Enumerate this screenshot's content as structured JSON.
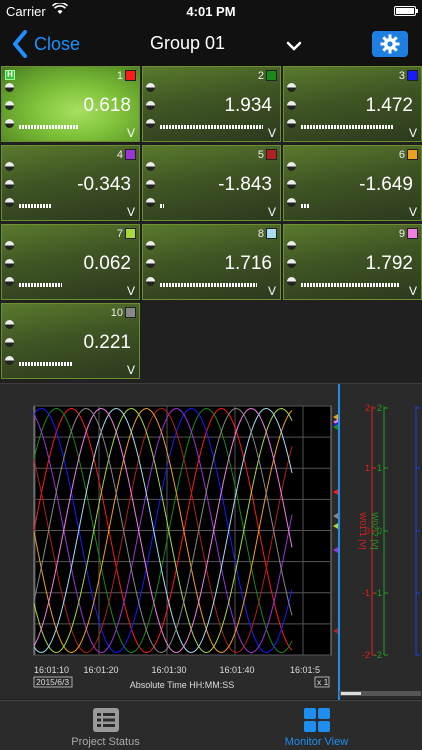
{
  "status_bar": {
    "carrier": "Carrier",
    "time": "4:01 PM"
  },
  "nav": {
    "back_label": "Close",
    "title": "Group 01"
  },
  "channels": [
    {
      "num": "1",
      "value": "0.618",
      "unit": "V",
      "color": "#ff1a1a",
      "level": 0.55,
      "highlight": true,
      "badge": "H"
    },
    {
      "num": "2",
      "value": "1.934",
      "unit": "V",
      "color": "#1a8a1a",
      "level": 0.95
    },
    {
      "num": "3",
      "value": "1.472",
      "unit": "V",
      "color": "#1a1aff",
      "level": 0.85
    },
    {
      "num": "4",
      "value": "-0.343",
      "unit": "V",
      "color": "#9a35d8",
      "level": 0.3
    },
    {
      "num": "5",
      "value": "-1.843",
      "unit": "V",
      "color": "#b02020",
      "level": 0.03
    },
    {
      "num": "6",
      "value": "-1.649",
      "unit": "V",
      "color": "#f0a020",
      "level": 0.08
    },
    {
      "num": "7",
      "value": "0.062",
      "unit": "V",
      "color": "#a8d840",
      "level": 0.4
    },
    {
      "num": "8",
      "value": "1.716",
      "unit": "V",
      "color": "#a8dcf0",
      "level": 0.9
    },
    {
      "num": "9",
      "value": "1.792",
      "unit": "V",
      "color": "#f080e0",
      "level": 0.92
    },
    {
      "num": "10",
      "value": "0.221",
      "unit": "V",
      "color": "#888888",
      "level": 0.5
    }
  ],
  "chart": {
    "x_ticks": [
      "16:01:10",
      "16:01:20",
      "16:01:30",
      "16:01:40",
      "16:01:5"
    ],
    "date": "2015/6/3",
    "xlabel": "Absolute Time HH:MM:SS",
    "zoom": "x 1",
    "axis1": {
      "label": "W01:1 [V]",
      "ticks": [
        "2",
        "1",
        "0",
        "-1",
        "-2"
      ],
      "color": "#e02020"
    },
    "axis2": {
      "label": "W02:2 [V]",
      "ticks": [
        "2",
        "1",
        "0",
        "-1",
        "-2"
      ],
      "color": "#20a020"
    },
    "axis3": {
      "color": "#2040e0"
    }
  },
  "tabs": [
    {
      "label": "Project Status",
      "active": false,
      "icon": "list-icon"
    },
    {
      "label": "Monitor View",
      "active": true,
      "icon": "grid-icon"
    }
  ]
}
